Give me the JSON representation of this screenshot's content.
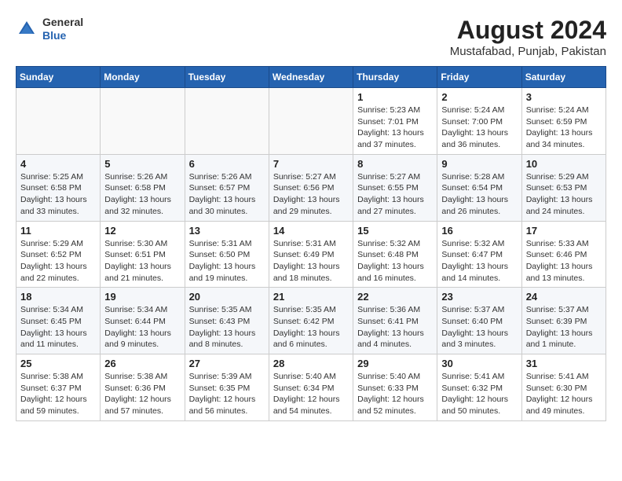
{
  "logo": {
    "general": "General",
    "blue": "Blue"
  },
  "header": {
    "month_year": "August 2024",
    "location": "Mustafabad, Punjab, Pakistan"
  },
  "weekdays": [
    "Sunday",
    "Monday",
    "Tuesday",
    "Wednesday",
    "Thursday",
    "Friday",
    "Saturday"
  ],
  "weeks": [
    [
      {
        "day": "",
        "info": ""
      },
      {
        "day": "",
        "info": ""
      },
      {
        "day": "",
        "info": ""
      },
      {
        "day": "",
        "info": ""
      },
      {
        "day": "1",
        "info": "Sunrise: 5:23 AM\nSunset: 7:01 PM\nDaylight: 13 hours\nand 37 minutes."
      },
      {
        "day": "2",
        "info": "Sunrise: 5:24 AM\nSunset: 7:00 PM\nDaylight: 13 hours\nand 36 minutes."
      },
      {
        "day": "3",
        "info": "Sunrise: 5:24 AM\nSunset: 6:59 PM\nDaylight: 13 hours\nand 34 minutes."
      }
    ],
    [
      {
        "day": "4",
        "info": "Sunrise: 5:25 AM\nSunset: 6:58 PM\nDaylight: 13 hours\nand 33 minutes."
      },
      {
        "day": "5",
        "info": "Sunrise: 5:26 AM\nSunset: 6:58 PM\nDaylight: 13 hours\nand 32 minutes."
      },
      {
        "day": "6",
        "info": "Sunrise: 5:26 AM\nSunset: 6:57 PM\nDaylight: 13 hours\nand 30 minutes."
      },
      {
        "day": "7",
        "info": "Sunrise: 5:27 AM\nSunset: 6:56 PM\nDaylight: 13 hours\nand 29 minutes."
      },
      {
        "day": "8",
        "info": "Sunrise: 5:27 AM\nSunset: 6:55 PM\nDaylight: 13 hours\nand 27 minutes."
      },
      {
        "day": "9",
        "info": "Sunrise: 5:28 AM\nSunset: 6:54 PM\nDaylight: 13 hours\nand 26 minutes."
      },
      {
        "day": "10",
        "info": "Sunrise: 5:29 AM\nSunset: 6:53 PM\nDaylight: 13 hours\nand 24 minutes."
      }
    ],
    [
      {
        "day": "11",
        "info": "Sunrise: 5:29 AM\nSunset: 6:52 PM\nDaylight: 13 hours\nand 22 minutes."
      },
      {
        "day": "12",
        "info": "Sunrise: 5:30 AM\nSunset: 6:51 PM\nDaylight: 13 hours\nand 21 minutes."
      },
      {
        "day": "13",
        "info": "Sunrise: 5:31 AM\nSunset: 6:50 PM\nDaylight: 13 hours\nand 19 minutes."
      },
      {
        "day": "14",
        "info": "Sunrise: 5:31 AM\nSunset: 6:49 PM\nDaylight: 13 hours\nand 18 minutes."
      },
      {
        "day": "15",
        "info": "Sunrise: 5:32 AM\nSunset: 6:48 PM\nDaylight: 13 hours\nand 16 minutes."
      },
      {
        "day": "16",
        "info": "Sunrise: 5:32 AM\nSunset: 6:47 PM\nDaylight: 13 hours\nand 14 minutes."
      },
      {
        "day": "17",
        "info": "Sunrise: 5:33 AM\nSunset: 6:46 PM\nDaylight: 13 hours\nand 13 minutes."
      }
    ],
    [
      {
        "day": "18",
        "info": "Sunrise: 5:34 AM\nSunset: 6:45 PM\nDaylight: 13 hours\nand 11 minutes."
      },
      {
        "day": "19",
        "info": "Sunrise: 5:34 AM\nSunset: 6:44 PM\nDaylight: 13 hours\nand 9 minutes."
      },
      {
        "day": "20",
        "info": "Sunrise: 5:35 AM\nSunset: 6:43 PM\nDaylight: 13 hours\nand 8 minutes."
      },
      {
        "day": "21",
        "info": "Sunrise: 5:35 AM\nSunset: 6:42 PM\nDaylight: 13 hours\nand 6 minutes."
      },
      {
        "day": "22",
        "info": "Sunrise: 5:36 AM\nSunset: 6:41 PM\nDaylight: 13 hours\nand 4 minutes."
      },
      {
        "day": "23",
        "info": "Sunrise: 5:37 AM\nSunset: 6:40 PM\nDaylight: 13 hours\nand 3 minutes."
      },
      {
        "day": "24",
        "info": "Sunrise: 5:37 AM\nSunset: 6:39 PM\nDaylight: 13 hours\nand 1 minute."
      }
    ],
    [
      {
        "day": "25",
        "info": "Sunrise: 5:38 AM\nSunset: 6:37 PM\nDaylight: 12 hours\nand 59 minutes."
      },
      {
        "day": "26",
        "info": "Sunrise: 5:38 AM\nSunset: 6:36 PM\nDaylight: 12 hours\nand 57 minutes."
      },
      {
        "day": "27",
        "info": "Sunrise: 5:39 AM\nSunset: 6:35 PM\nDaylight: 12 hours\nand 56 minutes."
      },
      {
        "day": "28",
        "info": "Sunrise: 5:40 AM\nSunset: 6:34 PM\nDaylight: 12 hours\nand 54 minutes."
      },
      {
        "day": "29",
        "info": "Sunrise: 5:40 AM\nSunset: 6:33 PM\nDaylight: 12 hours\nand 52 minutes."
      },
      {
        "day": "30",
        "info": "Sunrise: 5:41 AM\nSunset: 6:32 PM\nDaylight: 12 hours\nand 50 minutes."
      },
      {
        "day": "31",
        "info": "Sunrise: 5:41 AM\nSunset: 6:30 PM\nDaylight: 12 hours\nand 49 minutes."
      }
    ]
  ]
}
